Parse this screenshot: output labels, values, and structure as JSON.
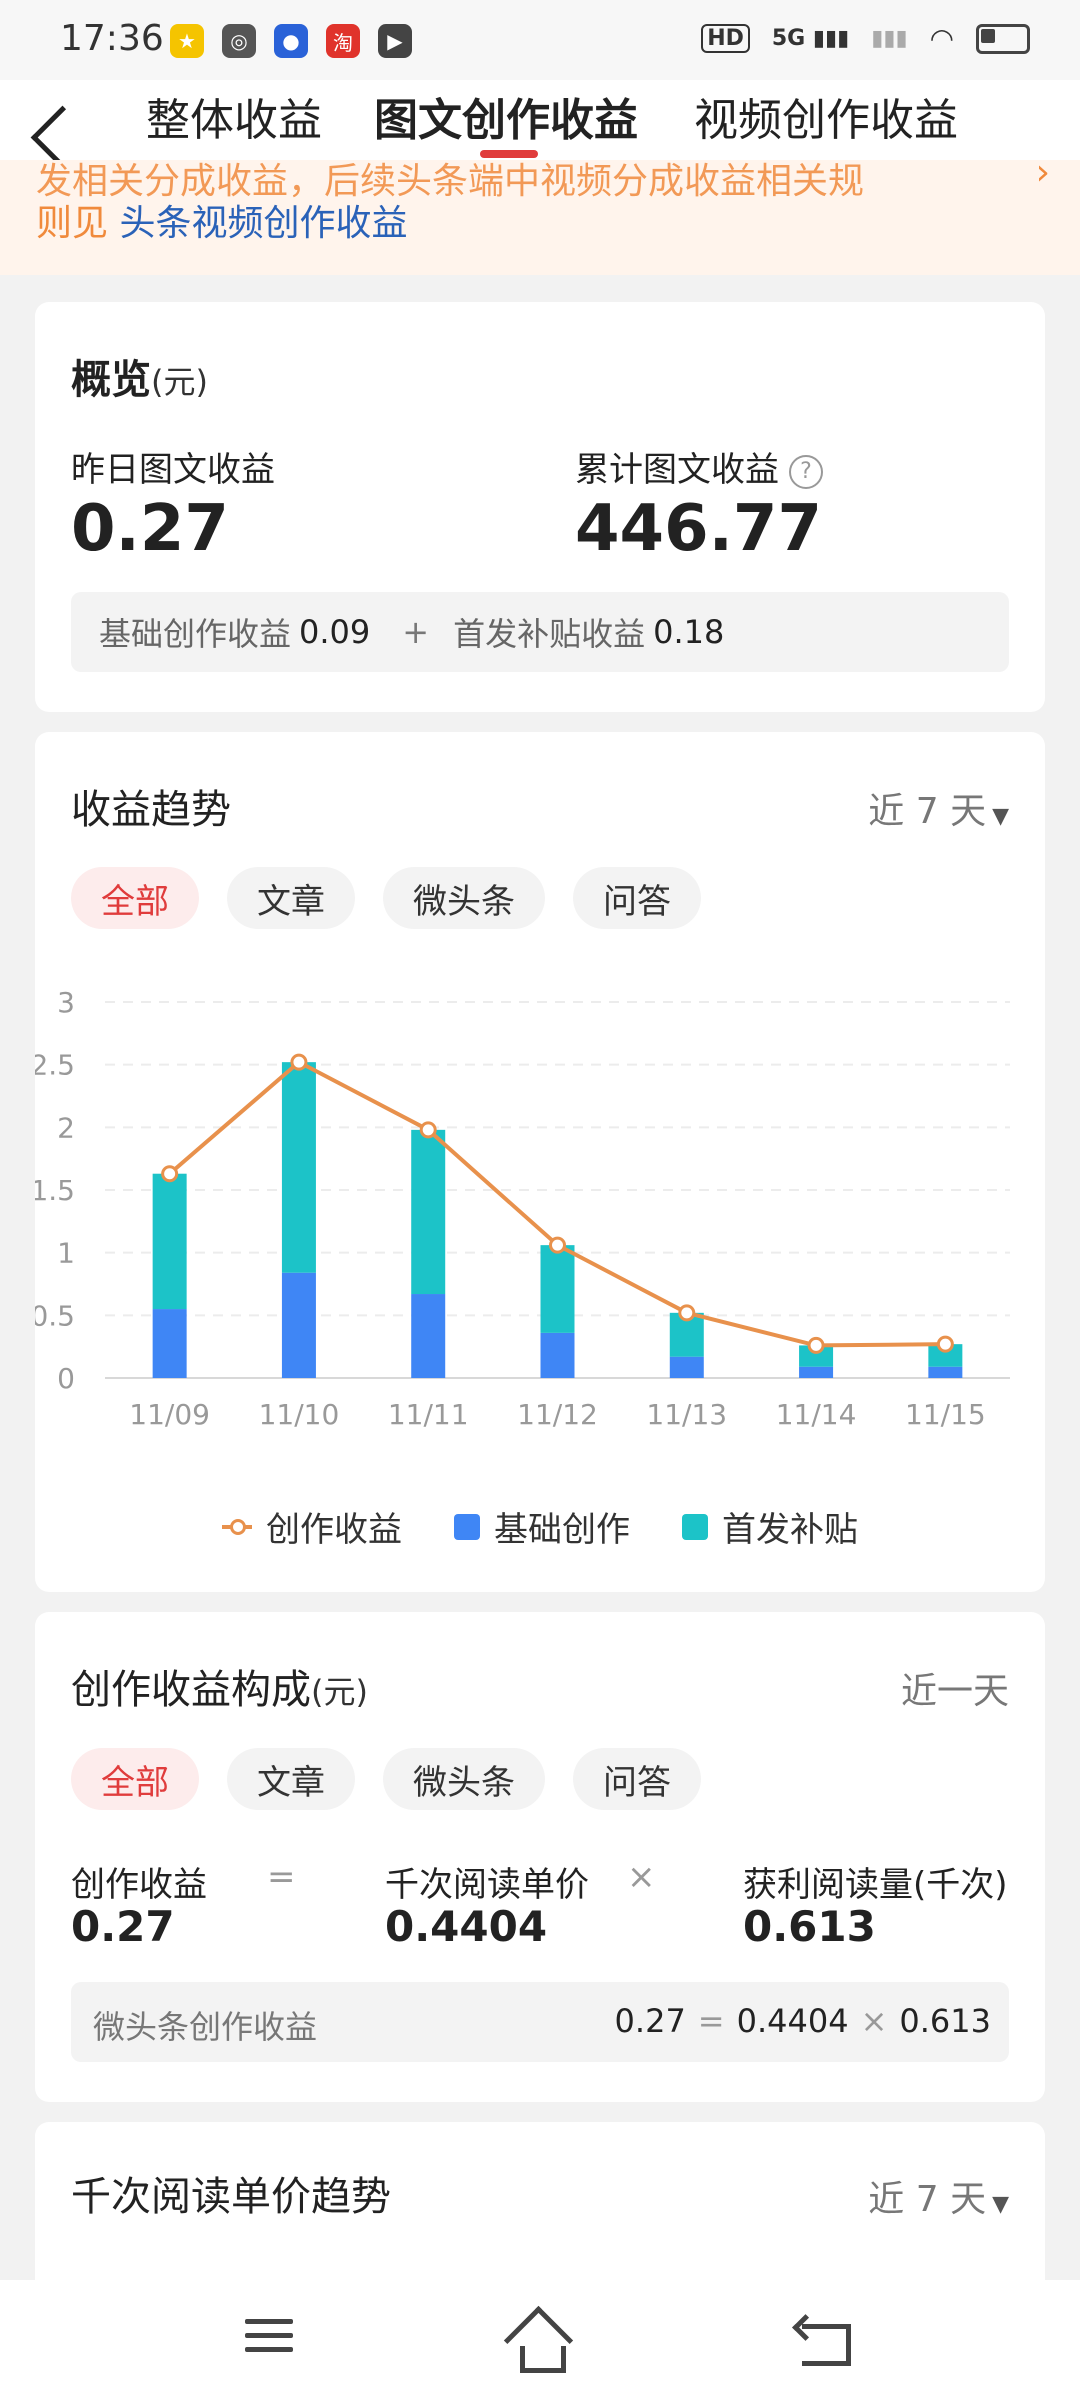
{
  "status_bar": {
    "time": "17:36",
    "network": "5G",
    "hd_badge": "HD"
  },
  "nav": {
    "tabs": [
      {
        "label": "整体收益"
      },
      {
        "label": "图文创作收益"
      },
      {
        "label": "视频创作收益"
      }
    ],
    "active_tab": "图文创作收益"
  },
  "banner": {
    "line1": "发相关分成收益，后续头条端中视频分成收益相关规",
    "line2_prefix": "则见",
    "line2_link": "头条视频创作收益"
  },
  "overview": {
    "title": "概览",
    "unit": "(元)",
    "yesterday_label": "昨日图文收益",
    "yesterday_value": "0.27",
    "total_label": "累计图文收益",
    "total_value": "446.77",
    "help_icon": "?",
    "base_label": "基础创作收益",
    "base_value": "0.09",
    "plus": "+",
    "subsidy_label": "首发补贴收益",
    "subsidy_value": "0.18"
  },
  "trend": {
    "title": "收益趋势",
    "range": "近 7 天",
    "pills": [
      "全部",
      "文章",
      "微头条",
      "问答"
    ],
    "active_pill": "全部"
  },
  "chart_data": {
    "type": "bar",
    "categories": [
      "11/09",
      "11/10",
      "11/11",
      "11/12",
      "11/13",
      "11/14",
      "11/15"
    ],
    "series": [
      {
        "name": "基础创作",
        "kind": "stacked-bar",
        "color": "#3f86f5",
        "values": [
          0.55,
          0.84,
          0.67,
          0.36,
          0.17,
          0.09,
          0.09
        ]
      },
      {
        "name": "首发补贴",
        "kind": "stacked-bar",
        "color": "#1cc3c8",
        "values": [
          1.08,
          1.68,
          1.31,
          0.7,
          0.35,
          0.17,
          0.18
        ]
      },
      {
        "name": "创作收益",
        "kind": "line",
        "color": "#e8914c",
        "values": [
          1.63,
          2.52,
          1.98,
          1.06,
          0.52,
          0.26,
          0.27
        ]
      }
    ],
    "yticks": [
      "0",
      "0.5",
      "1",
      "1.5",
      "2",
      "2.5",
      "3"
    ],
    "ylim": [
      0,
      3
    ],
    "grid": true,
    "legend_position": "bottom"
  },
  "composition": {
    "title": "创作收益构成",
    "unit": "(元)",
    "range": "近一天",
    "pills": [
      "全部",
      "文章",
      "微头条",
      "问答"
    ],
    "active_pill": "全部",
    "earnings_label": "创作收益",
    "earnings_value": "0.27",
    "eq": "=",
    "price_label": "千次阅读单价",
    "price_value": "0.4404",
    "times": "×",
    "reads_label": "获利阅读量(千次)",
    "reads_value": "0.613",
    "sub_label": "微头条创作收益",
    "sub_earnings": "0.27",
    "sub_price": "0.4404",
    "sub_reads": "0.613"
  },
  "price_trend": {
    "title": "千次阅读单价趋势",
    "range": "近 7 天"
  }
}
